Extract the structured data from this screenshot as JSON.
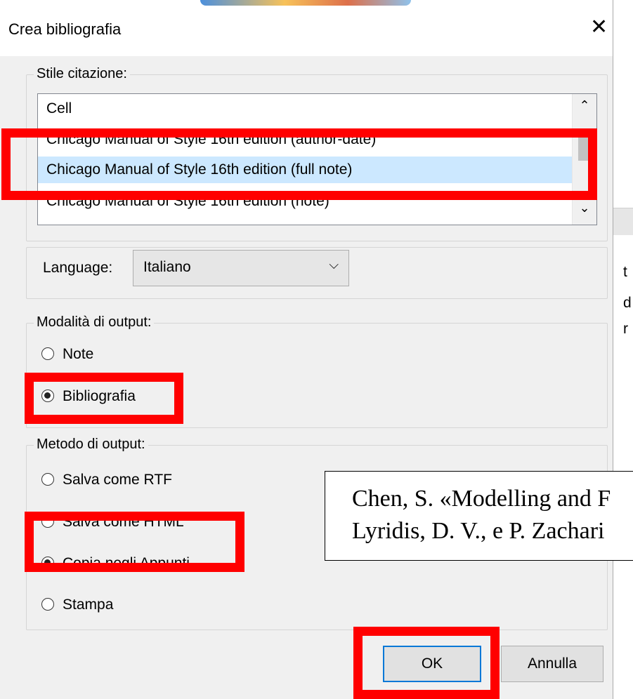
{
  "dialog": {
    "title": "Crea bibliografia",
    "close_glyph": "✕"
  },
  "citation_style": {
    "legend": "Stile citazione:",
    "items": [
      "Cell",
      "Chicago Manual of Style 16th edition (author-date)",
      "Chicago Manual of Style 16th edition (full note)",
      "Chicago Manual of Style 16th edition (note)"
    ],
    "selected_index": 2,
    "scroll_up": "⌃",
    "scroll_down": "⌄"
  },
  "language": {
    "label": "Language:",
    "value": "Italiano",
    "chevron": "⌵"
  },
  "output_mode": {
    "legend": "Modalità di output:",
    "options": [
      "Note",
      "Bibliografia"
    ],
    "selected": "Bibliografia"
  },
  "output_method": {
    "legend": "Metodo di output:",
    "options": [
      "Salva come RTF",
      "Salva come HTML",
      "Copia negli Appunti",
      "Stampa"
    ],
    "selected": "Copia negli Appunti"
  },
  "buttons": {
    "ok": "OK",
    "cancel": "Annulla"
  },
  "preview": {
    "lines": [
      "Chen, S. «Modelling and F",
      "Lyridis, D. V., e P. Zachari"
    ]
  },
  "background_window": {
    "chars": [
      "t",
      "d",
      "r"
    ]
  },
  "colors": {
    "highlight": "#ff0000",
    "selection": "#cce8ff",
    "default_button_border": "#0078d7"
  }
}
